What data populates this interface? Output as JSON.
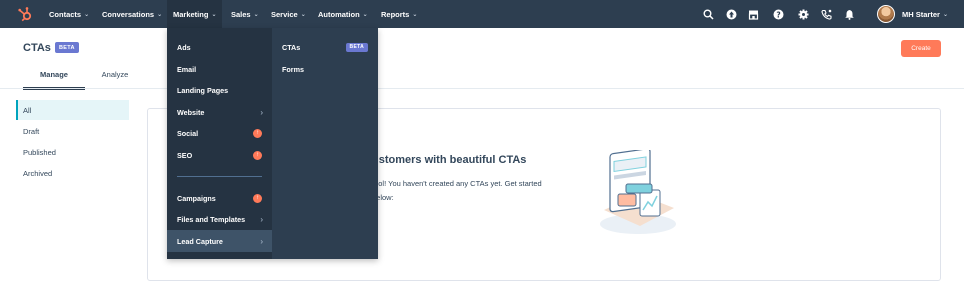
{
  "topnav": {
    "items": [
      {
        "label": "Contacts"
      },
      {
        "label": "Conversations"
      },
      {
        "label": "Marketing"
      },
      {
        "label": "Sales"
      },
      {
        "label": "Service"
      },
      {
        "label": "Automation"
      },
      {
        "label": "Reports"
      }
    ],
    "account_name": "MH Starter",
    "icons": [
      "search-icon",
      "upgrade-icon",
      "marketplace-icon",
      "help-icon",
      "settings-icon",
      "calling-icon",
      "notifications-icon"
    ]
  },
  "header": {
    "title": "CTAs",
    "badge": "BETA",
    "create_label": "Create"
  },
  "tabs": [
    {
      "label": "Manage",
      "active": true
    },
    {
      "label": "Analyze",
      "active": false
    }
  ],
  "filters": [
    {
      "label": "All",
      "active": true
    },
    {
      "label": "Draft"
    },
    {
      "label": "Published"
    },
    {
      "label": "Archived"
    }
  ],
  "empty_state": {
    "title_visible": "ustomers with beautiful CTAs",
    "text_line1": "tool! You haven't created any CTAs yet. Get started",
    "text_line2": "below:"
  },
  "marketing_menu": {
    "left": [
      {
        "label": "Ads"
      },
      {
        "label": "Email"
      },
      {
        "label": "Landing Pages"
      },
      {
        "label": "Website"
      },
      {
        "label": "Social"
      },
      {
        "label": "SEO"
      },
      {
        "label": "Campaigns"
      },
      {
        "label": "Files and Templates"
      },
      {
        "label": "Lead Capture"
      }
    ],
    "right": [
      {
        "label": "CTAs",
        "badge": "BETA"
      },
      {
        "label": "Forms"
      }
    ]
  },
  "colors": {
    "nav_bg": "#2d3e50",
    "accent_orange": "#ff7a59",
    "beta_purple": "#6a78d1",
    "active_teal": "#00a4bd"
  }
}
